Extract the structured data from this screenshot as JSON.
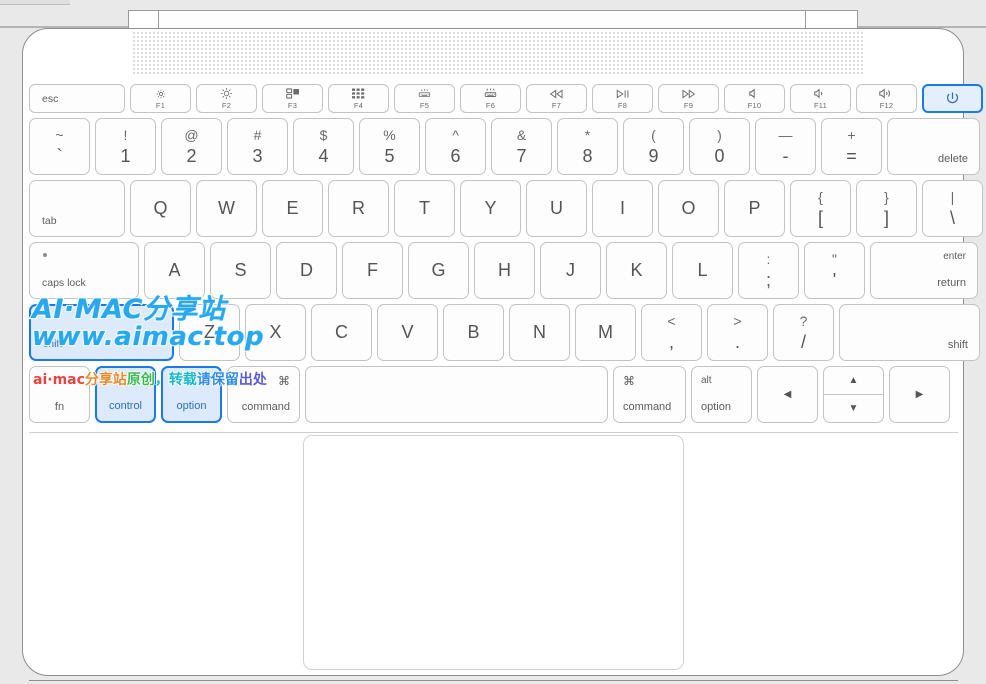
{
  "device": {
    "name": "macbook-keyboard-layout",
    "body_color": "#ffffff",
    "background_color": "#e9e9e9",
    "key_border_color": "#c3c3c3",
    "highlight_border_color": "#1a7aeb",
    "highlight_fill_color": "#dceafb"
  },
  "keyboard": {
    "function_row": [
      {
        "label": "esc",
        "fn": "",
        "icon": "",
        "highlight": false
      },
      {
        "label": "",
        "fn": "F1",
        "icon": "brightness-down-icon",
        "highlight": false
      },
      {
        "label": "",
        "fn": "F2",
        "icon": "brightness-up-icon",
        "highlight": false
      },
      {
        "label": "",
        "fn": "F3",
        "icon": "mission-control-icon",
        "highlight": false
      },
      {
        "label": "",
        "fn": "F4",
        "icon": "launchpad-icon",
        "highlight": false
      },
      {
        "label": "",
        "fn": "F5",
        "icon": "keyboard-backlight-down-icon",
        "highlight": false
      },
      {
        "label": "",
        "fn": "F6",
        "icon": "keyboard-backlight-up-icon",
        "highlight": false
      },
      {
        "label": "",
        "fn": "F7",
        "icon": "rewind-icon",
        "highlight": false
      },
      {
        "label": "",
        "fn": "F8",
        "icon": "play-pause-icon",
        "highlight": false
      },
      {
        "label": "",
        "fn": "F9",
        "icon": "fast-forward-icon",
        "highlight": false
      },
      {
        "label": "",
        "fn": "F10",
        "icon": "mute-icon",
        "highlight": false
      },
      {
        "label": "",
        "fn": "F11",
        "icon": "volume-down-icon",
        "highlight": false
      },
      {
        "label": "",
        "fn": "F12",
        "icon": "volume-up-icon",
        "highlight": false
      },
      {
        "label": "",
        "fn": "",
        "icon": "power-icon",
        "highlight": true
      }
    ],
    "number_row": [
      {
        "upper": "~",
        "lower": "`"
      },
      {
        "upper": "!",
        "lower": "1"
      },
      {
        "upper": "@",
        "lower": "2"
      },
      {
        "upper": "#",
        "lower": "3"
      },
      {
        "upper": "$",
        "lower": "4"
      },
      {
        "upper": "%",
        "lower": "5"
      },
      {
        "upper": "^",
        "lower": "6"
      },
      {
        "upper": "&",
        "lower": "7"
      },
      {
        "upper": "*",
        "lower": "8"
      },
      {
        "upper": "(",
        "lower": "9"
      },
      {
        "upper": ")",
        "lower": "0"
      },
      {
        "upper": "—",
        "lower": "-"
      },
      {
        "upper": "+",
        "lower": "="
      }
    ],
    "delete_key": "delete",
    "tab_key": "tab",
    "q_row": [
      {
        "single": "Q"
      },
      {
        "single": "W"
      },
      {
        "single": "E"
      },
      {
        "single": "R"
      },
      {
        "single": "T"
      },
      {
        "single": "Y"
      },
      {
        "single": "U"
      },
      {
        "single": "I"
      },
      {
        "single": "O"
      },
      {
        "single": "P"
      }
    ],
    "q_row_dual": [
      {
        "upper": "{",
        "lower": "["
      },
      {
        "upper": "}",
        "lower": "]"
      },
      {
        "upper": "|",
        "lower": "\\"
      }
    ],
    "caps_lock_key": "caps lock",
    "a_row": [
      {
        "single": "A"
      },
      {
        "single": "S"
      },
      {
        "single": "D"
      },
      {
        "single": "F"
      },
      {
        "single": "G"
      },
      {
        "single": "H"
      },
      {
        "single": "J"
      },
      {
        "single": "K"
      },
      {
        "single": "L"
      }
    ],
    "a_row_dual": [
      {
        "upper": ":",
        "lower": ";"
      },
      {
        "upper": "\"",
        "lower": "'"
      }
    ],
    "return_key": {
      "top": "enter",
      "bottom": "return"
    },
    "shift_left_key": "shift",
    "z_row": [
      {
        "single": "Z"
      },
      {
        "single": "X"
      },
      {
        "single": "C"
      },
      {
        "single": "V"
      },
      {
        "single": "B"
      },
      {
        "single": "N"
      },
      {
        "single": "M"
      }
    ],
    "z_row_dual": [
      {
        "upper": "<",
        "lower": ","
      },
      {
        "upper": ">",
        "lower": "."
      },
      {
        "upper": "?",
        "lower": "/"
      }
    ],
    "shift_right_key": "shift",
    "bottom_row": {
      "fn": "fn",
      "control": "control",
      "option_left": "option",
      "command_left": "command",
      "command_symbol": "⌘",
      "space": "",
      "command_right": "command",
      "option_right_top": "alt",
      "option_right_bottom": "option",
      "arrow_left": "◀",
      "arrow_up": "▲",
      "arrow_down": "▼",
      "arrow_right": "▶"
    },
    "highlighted_keys": [
      "power",
      "shift-left",
      "control",
      "option-left"
    ]
  },
  "watermark": {
    "line1": "AI·MAC分享站",
    "line2": "www.aimac.top",
    "color": "#2aa8ee",
    "notice_parts": [
      {
        "text": "ai·mac",
        "color": "#e8443f"
      },
      {
        "text": "分享站",
        "color": "#e98a2b"
      },
      {
        "text": "原创",
        "color": "#3fba52"
      },
      {
        "text": "，转载",
        "color": "#16b7c9"
      },
      {
        "text": "请保留",
        "color": "#2f8fe8"
      },
      {
        "text": "出处",
        "color": "#5b5bd6"
      }
    ]
  }
}
